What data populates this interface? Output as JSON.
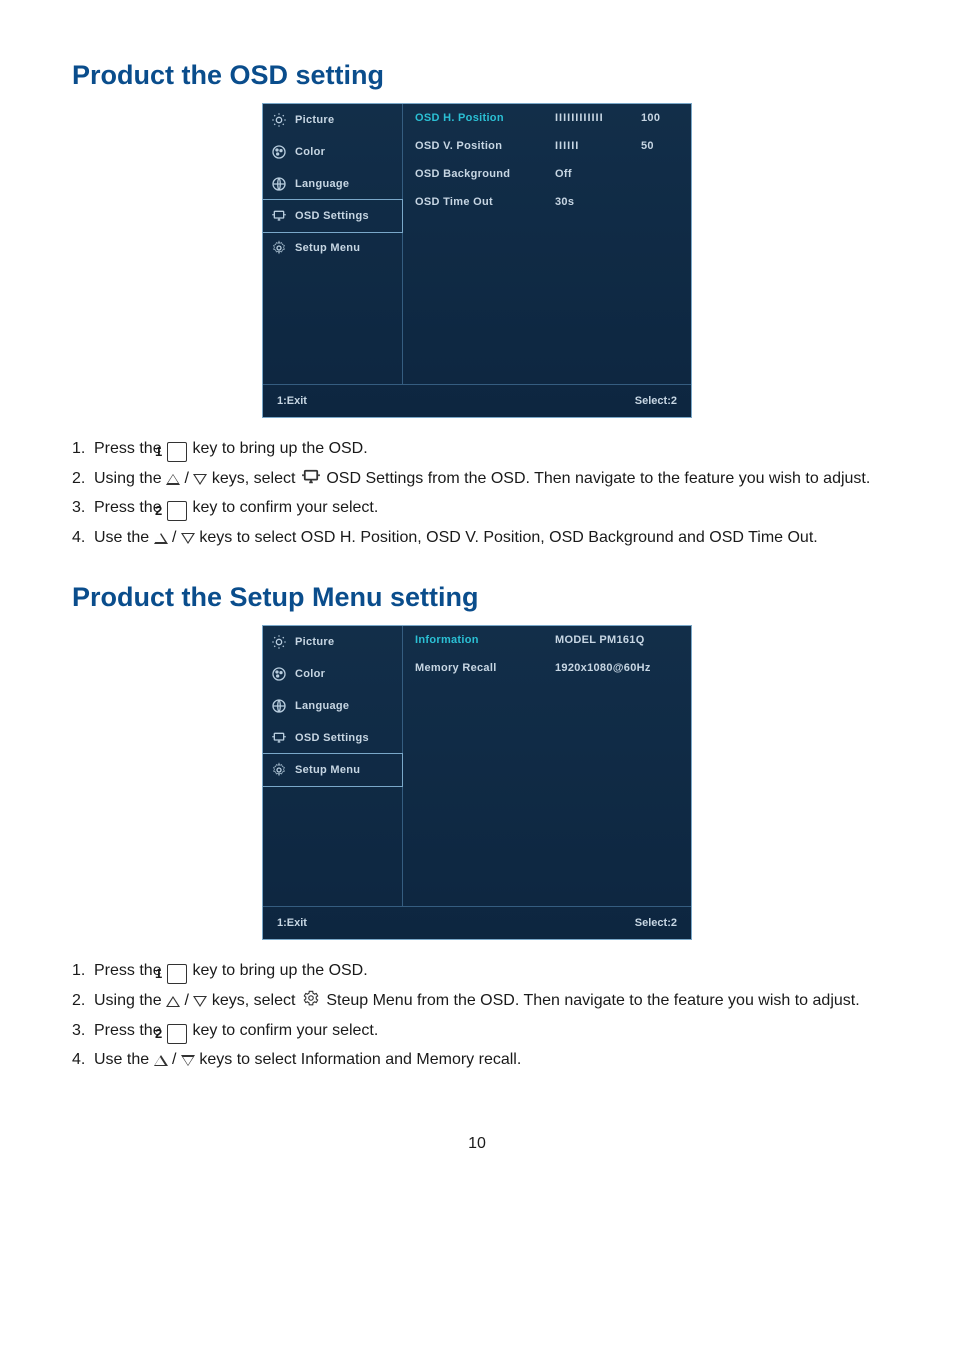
{
  "page_number": "10",
  "section1": {
    "heading": "Product the OSD setting",
    "osd": {
      "sidebar": [
        {
          "label": "Picture",
          "icon": "sun-icon"
        },
        {
          "label": "Color",
          "icon": "palette-icon"
        },
        {
          "label": "Language",
          "icon": "globe-icon"
        },
        {
          "label": "OSD Settings",
          "icon": "osd-icon",
          "active": true
        },
        {
          "label": "Setup Menu",
          "icon": "gear-icon"
        }
      ],
      "rows": [
        {
          "label": "OSD H. Position",
          "ticks": "IIIIIIIIIIII",
          "value": "100",
          "highlight": true
        },
        {
          "label": "OSD V. Position",
          "ticks": "IIIIII",
          "value": "50"
        },
        {
          "label": "OSD Background",
          "value": "Off"
        },
        {
          "label": "OSD Time Out",
          "value": "30s"
        }
      ],
      "footer_left": "1:Exit",
      "footer_right": "Select:2"
    },
    "steps": {
      "s1a": "Press the ",
      "s1b": " key to bring up the OSD.",
      "s2a": "Using the ",
      "s2b": " keys, select ",
      "s2c": " OSD Settings from the OSD. Then navigate to the feature you wish to adjust.",
      "s3a": "Press the ",
      "s3b": " key to confirm your select.",
      "s4a": "Use the ",
      "s4b": " keys to select OSD H. Position, OSD V. Position, OSD Background and OSD Time Out."
    }
  },
  "section2": {
    "heading": "Product the Setup Menu setting",
    "osd": {
      "sidebar": [
        {
          "label": "Picture",
          "icon": "sun-icon"
        },
        {
          "label": "Color",
          "icon": "palette-icon"
        },
        {
          "label": "Language",
          "icon": "globe-icon"
        },
        {
          "label": "OSD Settings",
          "icon": "osd-icon"
        },
        {
          "label": "Setup Menu",
          "icon": "gear-icon",
          "active": true
        }
      ],
      "rows": [
        {
          "label": "Information",
          "value": "MODEL PM161Q",
          "highlight": true
        },
        {
          "label": "Memory Recall",
          "value": "1920x1080@60Hz"
        }
      ],
      "footer_left": "1:Exit",
      "footer_right": "Select:2"
    },
    "steps": {
      "s1a": "Press the ",
      "s1b": " key to bring up the OSD.",
      "s2a": "Using the ",
      "s2b": " keys, select ",
      "s2c": " Steup Menu from the OSD. Then navigate to the feature you wish to adjust.",
      "s3a": "Press the ",
      "s3b": " key to confirm your select.",
      "s4a": "Use the ",
      "s4b": " keys to select Information and Memory recall."
    }
  },
  "keys": {
    "one": "1",
    "two": "2"
  }
}
